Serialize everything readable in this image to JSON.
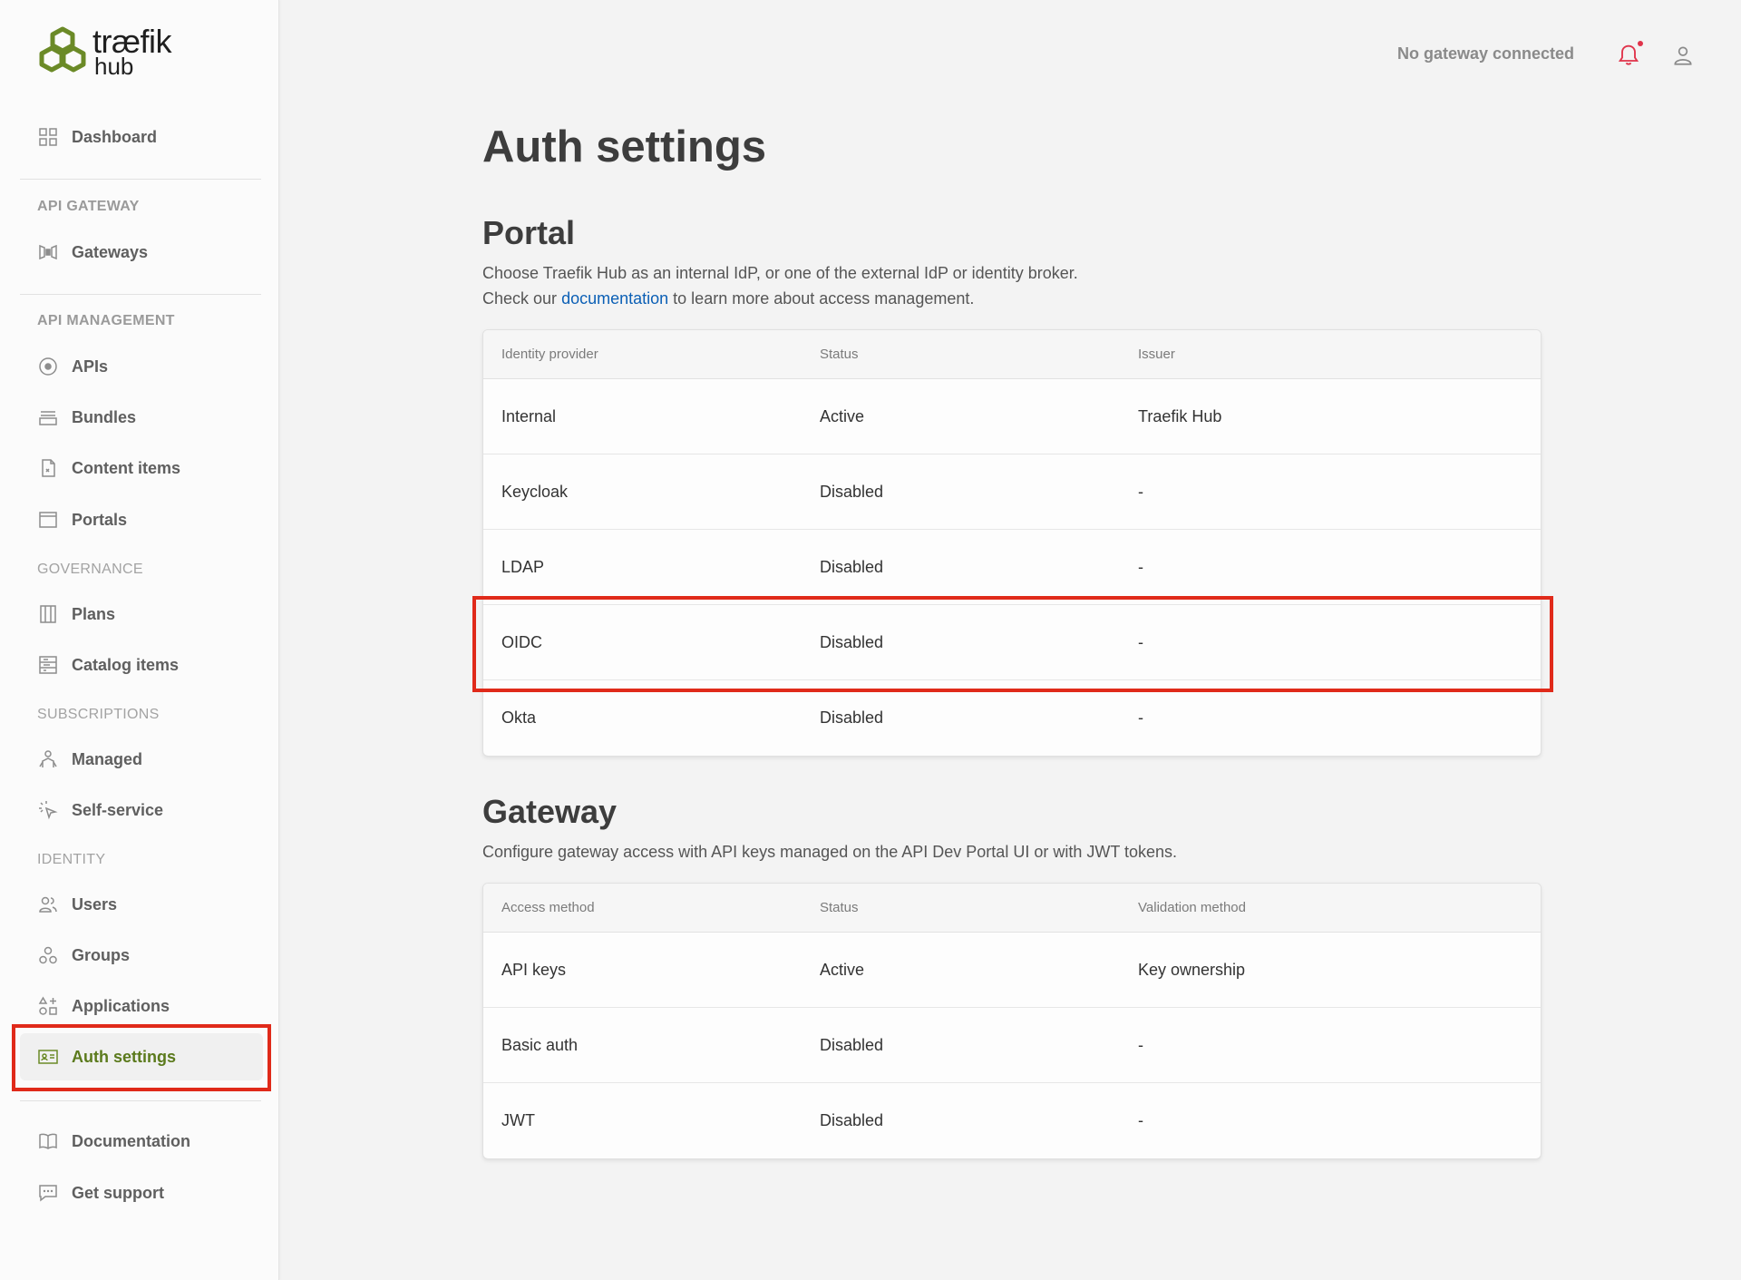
{
  "brand": {
    "name_line1": "træfik",
    "name_line2": "hub",
    "color": "#6b8a27"
  },
  "topbar": {
    "status": "No gateway connected",
    "bell_icon": "bell-icon",
    "user_icon": "user-icon"
  },
  "sidebar": {
    "dashboard": "Dashboard",
    "sections": {
      "api_gateway": "API GATEWAY",
      "api_management": "API MANAGEMENT",
      "governance": "GOVERNANCE",
      "subscriptions": "SUBSCRIPTIONS",
      "identity": "IDENTITY"
    },
    "items": {
      "gateways": "Gateways",
      "apis": "APIs",
      "bundles": "Bundles",
      "content_items": "Content items",
      "portals": "Portals",
      "plans": "Plans",
      "catalog_items": "Catalog items",
      "managed": "Managed",
      "self_service": "Self-service",
      "users": "Users",
      "groups": "Groups",
      "applications": "Applications",
      "auth_settings": "Auth settings",
      "documentation": "Documentation",
      "get_support": "Get support"
    },
    "active_item": "Auth settings"
  },
  "main": {
    "title": "Auth settings",
    "portal": {
      "heading": "Portal",
      "desc_line1": "Choose Traefik Hub as an internal IdP, or one of the external IdP or identity broker.",
      "desc_line2_prefix": "Check our",
      "desc_link": "documentation",
      "desc_line2_suffix": "to learn more about access management.",
      "columns": [
        "Identity provider",
        "Status",
        "Issuer"
      ],
      "rows": [
        [
          "Internal",
          "Active",
          "Traefik Hub"
        ],
        [
          "Keycloak",
          "Disabled",
          "-"
        ],
        [
          "LDAP",
          "Disabled",
          "-"
        ],
        [
          "OIDC",
          "Disabled",
          "-"
        ],
        [
          "Okta",
          "Disabled",
          "-"
        ]
      ]
    },
    "gateway": {
      "heading": "Gateway",
      "desc": "Configure gateway access with API keys managed on the API Dev Portal UI or with JWT tokens.",
      "columns": [
        "Access method",
        "Status",
        "Validation method"
      ],
      "rows": [
        [
          "API keys",
          "Active",
          "Key ownership"
        ],
        [
          "Basic auth",
          "Disabled",
          "-"
        ],
        [
          "JWT",
          "Disabled",
          "-"
        ]
      ]
    }
  }
}
